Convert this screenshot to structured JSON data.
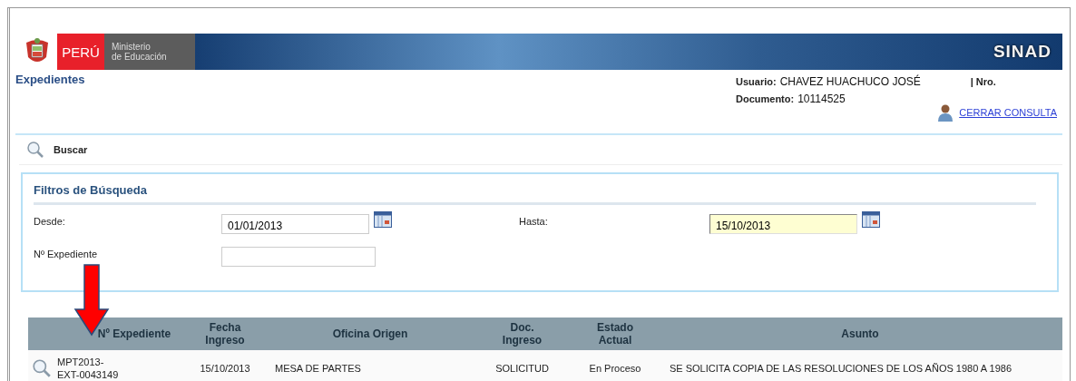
{
  "header": {
    "brand": "PERÚ",
    "ministry_line1": "Ministerio",
    "ministry_line2": "de Educación",
    "system": "SINAD"
  },
  "page_title": "Expedientes",
  "user": {
    "user_label": "Usuario:",
    "user_name": "CHAVEZ HUACHUCO JOSÉ",
    "nro_label": "| Nro.",
    "doc_label": "Documento:",
    "doc_number": "10114525",
    "logout_link": "CERRAR CONSULTA"
  },
  "search_bar": {
    "label": "Buscar"
  },
  "filters": {
    "title": "Filtros de Búsqueda",
    "fields": [
      {
        "label": "Desde:",
        "value": "01/01/2013",
        "kind": "date",
        "focused": false
      },
      {
        "label": "Hasta:",
        "value": "15/10/2013",
        "kind": "date",
        "focused": true
      },
      {
        "label": "Nº Expediente",
        "kind": "text",
        "focused": false
      }
    ]
  },
  "table": {
    "columns": [
      "Nº Expediente",
      "Fecha Ingreso",
      "Oficina Origen",
      "Doc. Ingreso",
      "Estado Actual",
      "Asunto"
    ],
    "rows": [
      {
        "cells": [
          "MPT2013-EXT-0043149",
          "15/10/2013",
          "MESA DE PARTES",
          "SOLICITUD",
          "En Proceso",
          "SE SOLICITA COPIA DE LAS RESOLUCIONES DE LOS AÑOS 1980 A 1986"
        ]
      }
    ]
  }
}
